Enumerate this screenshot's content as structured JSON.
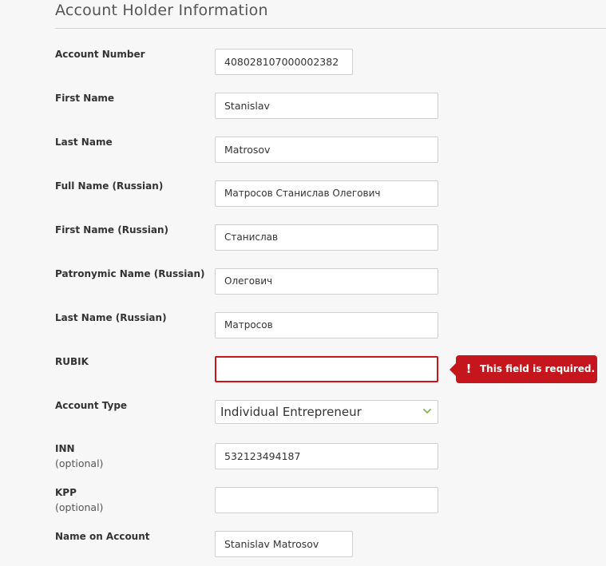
{
  "section": {
    "title": "Account Holder Information"
  },
  "fields": {
    "account_number": {
      "label": "Account Number",
      "value": "408028107000002382"
    },
    "first_name": {
      "label": "First Name",
      "value": "Stanislav"
    },
    "last_name": {
      "label": "Last Name",
      "value": "Matrosov"
    },
    "full_name_ru": {
      "label": "Full Name (Russian)",
      "value": "Матросов Станислав Олегович"
    },
    "first_name_ru": {
      "label": "First Name (Russian)",
      "value": "Станислав"
    },
    "patronymic_ru": {
      "label": "Patronymic Name (Russian)",
      "value": "Олегович"
    },
    "last_name_ru": {
      "label": "Last Name (Russian)",
      "value": "Матросов"
    },
    "rubik": {
      "label": "RUBIK",
      "value": "",
      "error": "This field is required."
    },
    "account_type": {
      "label": "Account Type",
      "value": "Individual Entrepreneur",
      "icon": "chevron-down-icon"
    },
    "inn": {
      "label": "INN",
      "optional": "(optional)",
      "value": "532123494187"
    },
    "kpp": {
      "label": "KPP",
      "optional": "(optional)",
      "value": ""
    },
    "name_on_account": {
      "label": "Name on Account",
      "value": "Stanislav Matrosov"
    }
  },
  "colors": {
    "error": "#c4161c",
    "chevron": "#7ab648",
    "background": "#f7f7f7"
  }
}
